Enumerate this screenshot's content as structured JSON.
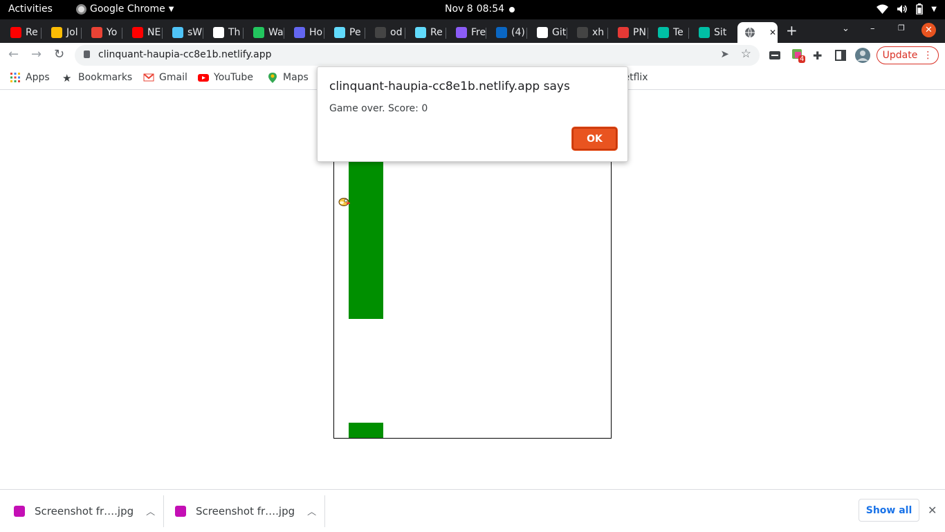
{
  "system_bar": {
    "activities": "Activities",
    "app_name": "Google Chrome",
    "date": "Nov 8",
    "time": "08:54"
  },
  "tabs": [
    {
      "label": "Re",
      "color": "#ff0000"
    },
    {
      "label": "Jol",
      "color": "#fbbc04"
    },
    {
      "label": "Yo",
      "color": "#ea4335"
    },
    {
      "label": "NE",
      "color": "#ff0000"
    },
    {
      "label": "sW",
      "color": "#4fc3f7"
    },
    {
      "label": "Th",
      "color": "#ffffff"
    },
    {
      "label": "Wa",
      "color": "#22c55e"
    },
    {
      "label": "Ho",
      "color": "#6366f1"
    },
    {
      "label": "Pe",
      "color": "#61dafb"
    },
    {
      "label": "od",
      "color": "#444444"
    },
    {
      "label": "Re",
      "color": "#61dafb"
    },
    {
      "label": "Fre",
      "color": "#8b5cf6"
    },
    {
      "label": "(4)",
      "color": "#0a66c2"
    },
    {
      "label": "Git",
      "color": "#ffffff"
    },
    {
      "label": "xh",
      "color": "#444444"
    },
    {
      "label": "PN",
      "color": "#e53935"
    },
    {
      "label": "Te",
      "color": "#00bfa5"
    },
    {
      "label": "Sit",
      "color": "#00bfa5"
    }
  ],
  "active_tab": {
    "label": "",
    "close": "✕"
  },
  "omnibox": {
    "url": "clinquant-haupia-cc8e1b.netlify.app"
  },
  "update_button": "Update",
  "extension_badge": "4",
  "bookmarks": [
    {
      "label": "Apps",
      "icon": "apps-grid-icon"
    },
    {
      "label": "Bookmarks",
      "icon": "star-icon"
    },
    {
      "label": "Gmail",
      "icon": "gmail-icon"
    },
    {
      "label": "YouTube",
      "icon": "youtube-icon"
    },
    {
      "label": "Maps",
      "icon": "maps-pin-icon"
    },
    {
      "label": "Netflix",
      "icon": "netflix-icon"
    }
  ],
  "game": {
    "pipe_color": "#008f00"
  },
  "dialog": {
    "title": "clinquant-haupia-cc8e1b.netlify.app says",
    "message": "Game over. Score: 0",
    "ok_label": "OK"
  },
  "downloads": [
    {
      "name": "Screenshot fr….jpg"
    },
    {
      "name": "Screenshot fr….jpg"
    }
  ],
  "show_all_label": "Show all"
}
